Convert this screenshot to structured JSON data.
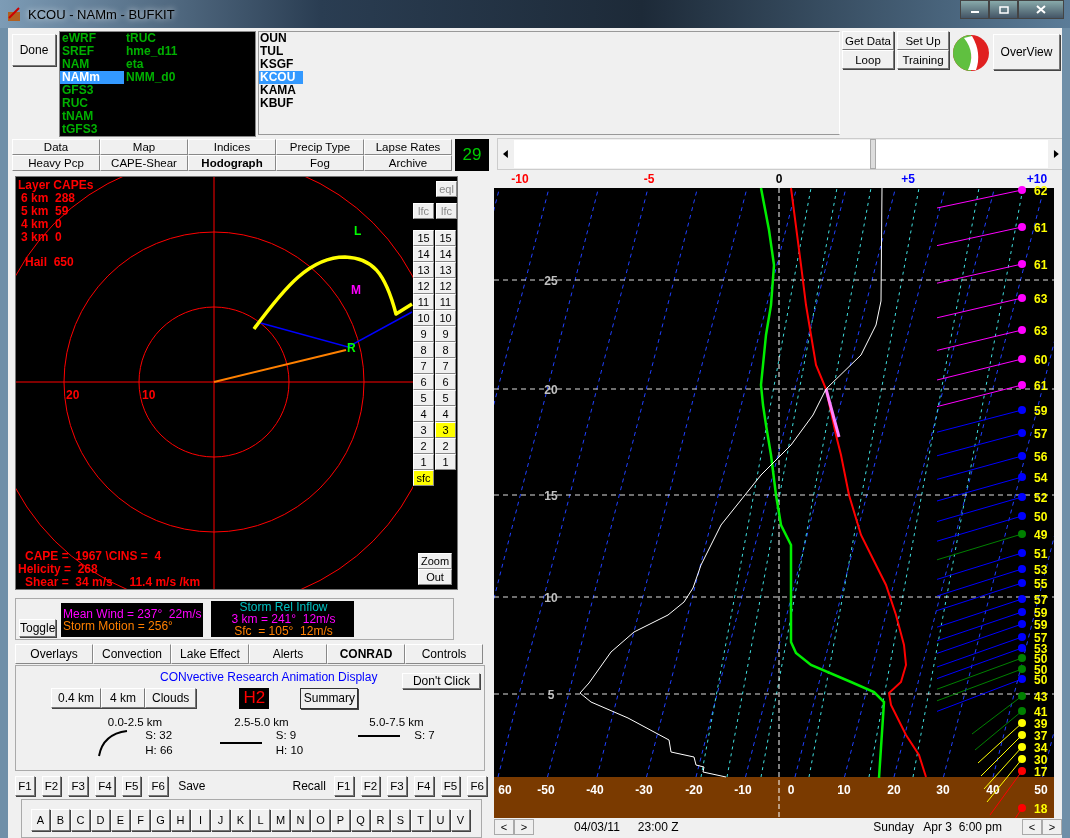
{
  "window": {
    "title": "KCOU - NAMm - BUFKIT"
  },
  "done_button": "Done",
  "model_columns": [
    [
      {
        "label": "eWRF",
        "selected": false
      },
      {
        "label": "SREF",
        "selected": false
      },
      {
        "label": "NAM",
        "selected": false
      },
      {
        "label": "NAMm",
        "selected": true
      },
      {
        "label": "GFS3",
        "selected": false
      },
      {
        "label": "RUC",
        "selected": false
      },
      {
        "label": "tNAM",
        "selected": false
      },
      {
        "label": "tGFS3",
        "selected": false
      }
    ],
    [
      {
        "label": "tRUC",
        "selected": false
      },
      {
        "label": "hme_d11",
        "selected": false
      },
      {
        "label": "eta",
        "selected": false
      },
      {
        "label": "NMM_d0",
        "selected": false
      }
    ]
  ],
  "stations": [
    {
      "label": "OUN",
      "selected": false
    },
    {
      "label": "TUL",
      "selected": false
    },
    {
      "label": "KSGF",
      "selected": false
    },
    {
      "label": "KCOU",
      "selected": true
    },
    {
      "label": "KAMA",
      "selected": false
    },
    {
      "label": "KBUF",
      "selected": false
    }
  ],
  "toolbar_buttons": [
    [
      "Get Data",
      "Loop"
    ],
    [
      "Set Up",
      "Training"
    ]
  ],
  "overview_button": "OverView",
  "tabs": [
    {
      "label": "Data",
      "selected": false
    },
    {
      "label": "Map",
      "selected": false
    },
    {
      "label": "Indices",
      "selected": false
    },
    {
      "label": "Precip Type",
      "selected": false
    },
    {
      "label": "Lapse Rates",
      "selected": false
    },
    {
      "label": "Heavy Pcp",
      "selected": false
    },
    {
      "label": "CAPE-Shear",
      "selected": false
    },
    {
      "label": "Hodograph",
      "selected": true
    },
    {
      "label": "Fog",
      "selected": false
    },
    {
      "label": "Archive",
      "selected": false
    }
  ],
  "frame_counter": "29",
  "hodograph": {
    "layer_capes_title": "Layer CAPEs",
    "layer_capes": [
      "6 km  288",
      "5 km  59",
      "4 km  0",
      "3 km  0"
    ],
    "hail": "Hail  650",
    "ring_labels": [
      "20",
      "10"
    ],
    "markers": [
      {
        "label": "L",
        "color": "#00ff00"
      },
      {
        "label": "M",
        "color": "#ff00ff"
      },
      {
        "label": "R",
        "color": "#00ff00"
      }
    ],
    "stats": [
      "CAPE =  1967 \\CINS =  4",
      "Helicity =  268",
      "Shear =  34 m/s     11.4 m/s /km"
    ],
    "eql_button": "eql",
    "lfc_buttons": [
      "lfc",
      "lfc"
    ],
    "level_columns": [
      [
        {
          "label": "15",
          "selected": false
        },
        {
          "label": "14",
          "selected": false
        },
        {
          "label": "13",
          "selected": false
        },
        {
          "label": "12",
          "selected": false
        },
        {
          "label": "11",
          "selected": false
        },
        {
          "label": "10",
          "selected": false
        },
        {
          "label": "9",
          "selected": false
        },
        {
          "label": "8",
          "selected": false
        },
        {
          "label": "7",
          "selected": false
        },
        {
          "label": "6",
          "selected": false
        },
        {
          "label": "5",
          "selected": false
        },
        {
          "label": "4",
          "selected": false
        },
        {
          "label": "3",
          "selected": false
        },
        {
          "label": "2",
          "selected": false
        },
        {
          "label": "1",
          "selected": false
        },
        {
          "label": "sfc",
          "selected": true
        }
      ],
      [
        {
          "label": "15",
          "selected": false
        },
        {
          "label": "14",
          "selected": false
        },
        {
          "label": "13",
          "selected": false
        },
        {
          "label": "12",
          "selected": false
        },
        {
          "label": "11",
          "selected": false
        },
        {
          "label": "10",
          "selected": false
        },
        {
          "label": "9",
          "selected": false
        },
        {
          "label": "8",
          "selected": false
        },
        {
          "label": "7",
          "selected": false
        },
        {
          "label": "6",
          "selected": false
        },
        {
          "label": "5",
          "selected": false
        },
        {
          "label": "4",
          "selected": false
        },
        {
          "label": "3",
          "selected": true
        },
        {
          "label": "2",
          "selected": false
        },
        {
          "label": "1",
          "selected": false
        }
      ]
    ],
    "zoom_buttons": [
      "Zoom",
      "Out"
    ]
  },
  "winds": {
    "toggle": "Toggle",
    "mean_wind": "Mean Wind = 237°  22m/s",
    "storm_motion": "Storm Motion = 256°",
    "inflow_title": "Storm Rel Inflow",
    "inflow_3km": "3 km = 241°  12m/s",
    "inflow_sfc": "Sfc  = 105°  12m/s"
  },
  "bottom_tabs": [
    {
      "label": "Overlays",
      "selected": false
    },
    {
      "label": "Convection",
      "selected": false
    },
    {
      "label": "Lake Effect",
      "selected": false
    },
    {
      "label": "Alerts",
      "selected": false
    },
    {
      "label": "CONRAD",
      "selected": true
    },
    {
      "label": "Controls",
      "selected": false
    }
  ],
  "conrad": {
    "title": "CONvective Research Animation Display",
    "dont_click": "Don't Click",
    "layer_buttons": [
      "0.4 km",
      "4 km",
      "Clouds"
    ],
    "indicator": "H2",
    "summary": "Summary",
    "layers": [
      {
        "label": "0.0-2.5 km",
        "kind": "curve",
        "s": "S: 32",
        "h": "H: 66"
      },
      {
        "label": "2.5-5.0 km",
        "kind": "straight",
        "s": "S: 9",
        "h": "H: 10"
      },
      {
        "label": "5.0-7.5 km",
        "kind": "straight",
        "s": "S: 7"
      }
    ]
  },
  "save_keys": [
    "F1",
    "F2",
    "F3",
    "F4",
    "F5",
    "F6"
  ],
  "save_label": "Save",
  "recall_label": "Recall",
  "recall_keys": [
    "F1",
    "F2",
    "F3",
    "F4",
    "F5",
    "F6"
  ],
  "letters": [
    "A",
    "B",
    "C",
    "D",
    "E",
    "F",
    "G",
    "H",
    "I",
    "J",
    "K",
    "L",
    "M",
    "N",
    "O",
    "P",
    "Q",
    "R",
    "S",
    "T",
    "U",
    "V"
  ],
  "skewt": {
    "top_scale": [
      {
        "label": "-10",
        "color": "#ff0000"
      },
      {
        "label": "-5",
        "color": "#ff0000"
      },
      {
        "label": "0",
        "color": "#000000"
      },
      {
        "label": "+5",
        "color": "#0000ff"
      },
      {
        "label": "+10",
        "color": "#0000ff"
      }
    ],
    "heights": [
      "25",
      "20",
      "15",
      "10",
      "5"
    ],
    "temperatures": [
      "60",
      "-50",
      "-40",
      "-30",
      "-20",
      "-10",
      "0",
      "10",
      "20",
      "30",
      "40",
      "50"
    ],
    "winds": [
      {
        "speed": "62",
        "color": "#ff00ff"
      },
      {
        "speed": "61",
        "color": "#ff00ff"
      },
      {
        "speed": "61",
        "color": "#ff00ff"
      },
      {
        "speed": "63",
        "color": "#ff00ff"
      },
      {
        "speed": "63",
        "color": "#ff00ff"
      },
      {
        "speed": "60",
        "color": "#ff00ff"
      },
      {
        "speed": "61",
        "color": "#ff00ff"
      },
      {
        "speed": "59",
        "color": "#0000ff"
      },
      {
        "speed": "57",
        "color": "#0000ff"
      },
      {
        "speed": "56",
        "color": "#0000ff"
      },
      {
        "speed": "54",
        "color": "#0000ff"
      },
      {
        "speed": "52",
        "color": "#0000ff"
      },
      {
        "speed": "50",
        "color": "#0000ff"
      },
      {
        "speed": "49",
        "color": "#008000"
      },
      {
        "speed": "51",
        "color": "#0000ff"
      },
      {
        "speed": "53",
        "color": "#0000ff"
      },
      {
        "speed": "55",
        "color": "#0000ff"
      },
      {
        "speed": "57",
        "color": "#0000ff"
      },
      {
        "speed": "59",
        "color": "#0000ff"
      },
      {
        "speed": "59",
        "color": "#0000ff"
      },
      {
        "speed": "57",
        "color": "#0000ff"
      },
      {
        "speed": "53",
        "color": "#0000ff"
      },
      {
        "speed": "50",
        "color": "#008000"
      },
      {
        "speed": "50",
        "color": "#008000"
      },
      {
        "speed": "50",
        "color": "#0000ff"
      },
      {
        "speed": "43",
        "color": "#008000"
      },
      {
        "speed": "41",
        "color": "#008000"
      },
      {
        "speed": "39",
        "color": "#ffff00"
      },
      {
        "speed": "37",
        "color": "#ffff00"
      },
      {
        "speed": "34",
        "color": "#ffff00"
      },
      {
        "speed": "30",
        "color": "#ffff00"
      },
      {
        "speed": "17",
        "color": "#ff0000"
      },
      {
        "speed": "18",
        "color": "#ff0000"
      }
    ]
  },
  "status": {
    "nav_buttons": [
      "<",
      ">"
    ],
    "right_nav_buttons": [
      "<",
      ">"
    ],
    "date": "04/03/11",
    "time": "23:00 Z",
    "local_time": "Sunday   Apr 3  6:00 pm"
  }
}
